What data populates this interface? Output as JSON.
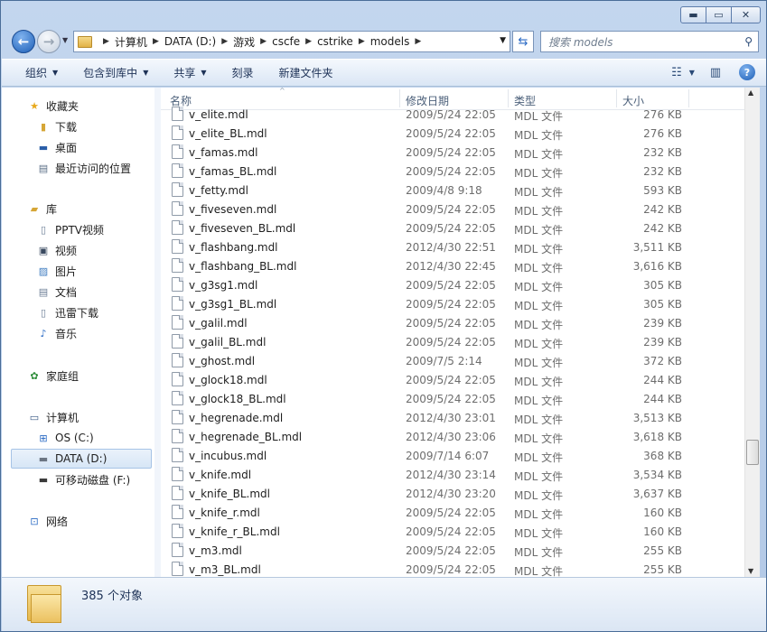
{
  "window": {
    "caption_buttons": {
      "minimize": "▬",
      "maximize": "▭",
      "close": "✕"
    }
  },
  "address": {
    "crumbs": [
      "计算机",
      "DATA (D:)",
      "游戏",
      "cscfe",
      "cstrike",
      "models"
    ],
    "search_placeholder": "搜索 models"
  },
  "toolbar": {
    "organize": "组织",
    "include_library": "包含到库中",
    "share": "共享",
    "burn": "刻录",
    "new_folder": "新建文件夹"
  },
  "nav": {
    "favorites": "收藏夹",
    "downloads": "下载",
    "desktop": "桌面",
    "recent": "最近访问的位置",
    "libraries": "库",
    "pptv": "PPTV视频",
    "videos": "视频",
    "pictures": "图片",
    "documents": "文档",
    "xunlei": "迅雷下载",
    "music": "音乐",
    "homegroup": "家庭组",
    "computer": "计算机",
    "os_c": "OS (C:)",
    "data_d": "DATA (D:)",
    "removable_f": "可移动磁盘 (F:)",
    "network": "网络"
  },
  "columns": {
    "name": "名称",
    "date": "修改日期",
    "type": "类型",
    "size": "大小"
  },
  "files": [
    {
      "name": "v_elite.mdl",
      "date": "2009/5/24 22:05",
      "type": "MDL 文件",
      "size": "276 KB"
    },
    {
      "name": "v_elite_BL.mdl",
      "date": "2009/5/24 22:05",
      "type": "MDL 文件",
      "size": "276 KB"
    },
    {
      "name": "v_famas.mdl",
      "date": "2009/5/24 22:05",
      "type": "MDL 文件",
      "size": "232 KB"
    },
    {
      "name": "v_famas_BL.mdl",
      "date": "2009/5/24 22:05",
      "type": "MDL 文件",
      "size": "232 KB"
    },
    {
      "name": "v_fetty.mdl",
      "date": "2009/4/8 9:18",
      "type": "MDL 文件",
      "size": "593 KB"
    },
    {
      "name": "v_fiveseven.mdl",
      "date": "2009/5/24 22:05",
      "type": "MDL 文件",
      "size": "242 KB"
    },
    {
      "name": "v_fiveseven_BL.mdl",
      "date": "2009/5/24 22:05",
      "type": "MDL 文件",
      "size": "242 KB"
    },
    {
      "name": "v_flashbang.mdl",
      "date": "2012/4/30 22:51",
      "type": "MDL 文件",
      "size": "3,511 KB"
    },
    {
      "name": "v_flashbang_BL.mdl",
      "date": "2012/4/30 22:45",
      "type": "MDL 文件",
      "size": "3,616 KB"
    },
    {
      "name": "v_g3sg1.mdl",
      "date": "2009/5/24 22:05",
      "type": "MDL 文件",
      "size": "305 KB"
    },
    {
      "name": "v_g3sg1_BL.mdl",
      "date": "2009/5/24 22:05",
      "type": "MDL 文件",
      "size": "305 KB"
    },
    {
      "name": "v_galil.mdl",
      "date": "2009/5/24 22:05",
      "type": "MDL 文件",
      "size": "239 KB"
    },
    {
      "name": "v_galil_BL.mdl",
      "date": "2009/5/24 22:05",
      "type": "MDL 文件",
      "size": "239 KB"
    },
    {
      "name": "v_ghost.mdl",
      "date": "2009/7/5 2:14",
      "type": "MDL 文件",
      "size": "372 KB"
    },
    {
      "name": "v_glock18.mdl",
      "date": "2009/5/24 22:05",
      "type": "MDL 文件",
      "size": "244 KB"
    },
    {
      "name": "v_glock18_BL.mdl",
      "date": "2009/5/24 22:05",
      "type": "MDL 文件",
      "size": "244 KB"
    },
    {
      "name": "v_hegrenade.mdl",
      "date": "2012/4/30 23:01",
      "type": "MDL 文件",
      "size": "3,513 KB"
    },
    {
      "name": "v_hegrenade_BL.mdl",
      "date": "2012/4/30 23:06",
      "type": "MDL 文件",
      "size": "3,618 KB"
    },
    {
      "name": "v_incubus.mdl",
      "date": "2009/7/14 6:07",
      "type": "MDL 文件",
      "size": "368 KB"
    },
    {
      "name": "v_knife.mdl",
      "date": "2012/4/30 23:14",
      "type": "MDL 文件",
      "size": "3,534 KB"
    },
    {
      "name": "v_knife_BL.mdl",
      "date": "2012/4/30 23:20",
      "type": "MDL 文件",
      "size": "3,637 KB"
    },
    {
      "name": "v_knife_r.mdl",
      "date": "2009/5/24 22:05",
      "type": "MDL 文件",
      "size": "160 KB"
    },
    {
      "name": "v_knife_r_BL.mdl",
      "date": "2009/5/24 22:05",
      "type": "MDL 文件",
      "size": "160 KB"
    },
    {
      "name": "v_m3.mdl",
      "date": "2009/5/24 22:05",
      "type": "MDL 文件",
      "size": "255 KB"
    },
    {
      "name": "v_m3_BL.mdl",
      "date": "2009/5/24 22:05",
      "type": "MDL 文件",
      "size": "255 KB"
    }
  ],
  "status": {
    "count": "385 个对象"
  }
}
